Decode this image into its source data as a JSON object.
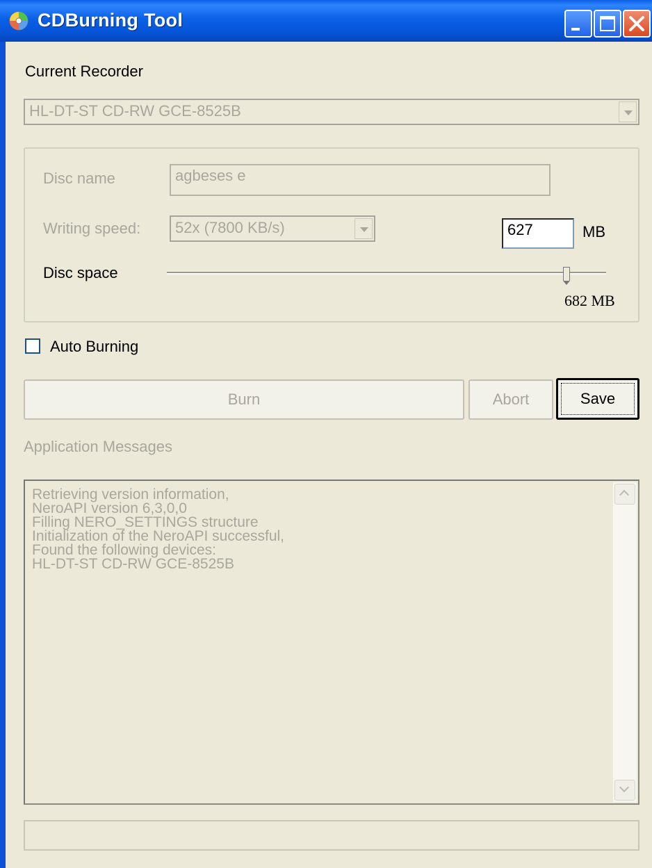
{
  "window": {
    "title": "CDBurning Tool",
    "controls": [
      "minimize",
      "maximize",
      "close"
    ]
  },
  "recorder": {
    "label": "Current Recorder",
    "selected": "HL-DT-ST CD-RW GCE-8525B"
  },
  "settings": {
    "disc_name_label": "Disc name",
    "disc_name_value": "agbeses e",
    "writing_speed_label": "Writing speed:",
    "writing_speed_value": "52x (7800 KB/s)",
    "size_value": "627",
    "size_unit": "MB",
    "disc_space_label": "Disc space",
    "disc_space_value": "682 MB",
    "disc_space_slider_fraction": 0.91
  },
  "auto_burning": {
    "label": "Auto Burning",
    "checked": false
  },
  "buttons": {
    "burn": "Burn",
    "abort": "Abort",
    "save": "Save"
  },
  "messages": {
    "label": "Application Messages",
    "lines": [
      "Retrieving version information,",
      "NeroAPI version 6,3,0,0",
      "Filling NERO_SETTINGS structure",
      "Initialization of the NeroAPI successful,",
      "Found the following devices:",
      "HL-DT-ST CD-RW GCE-8525B"
    ]
  },
  "icons": [
    "cd-icon",
    "minimize-icon",
    "maximize-icon",
    "close-icon",
    "chevron-down-icon",
    "scroll-up-icon",
    "scroll-down-icon"
  ]
}
